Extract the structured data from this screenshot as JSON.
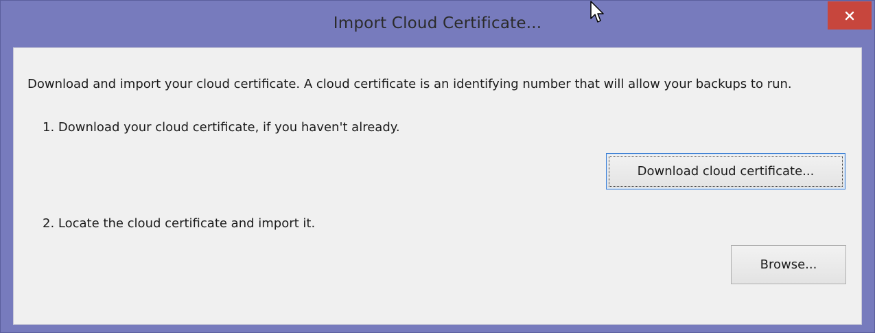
{
  "window": {
    "title": "Import Cloud Certificate...",
    "close_icon": "close-icon"
  },
  "content": {
    "intro": "Download and import your cloud certificate. A cloud certificate is an identifying number that will allow your backups to run.",
    "step1": "1. Download your cloud certificate, if you haven't already.",
    "download_button": "Download cloud certificate...",
    "step2": "2. Locate the cloud certificate and import it.",
    "browse_button": "Browse..."
  },
  "colors": {
    "titlebar": "#777bbd",
    "close_button": "#c7463d",
    "client_background": "#f0f0f0",
    "focus_border": "#3c7fd4"
  }
}
